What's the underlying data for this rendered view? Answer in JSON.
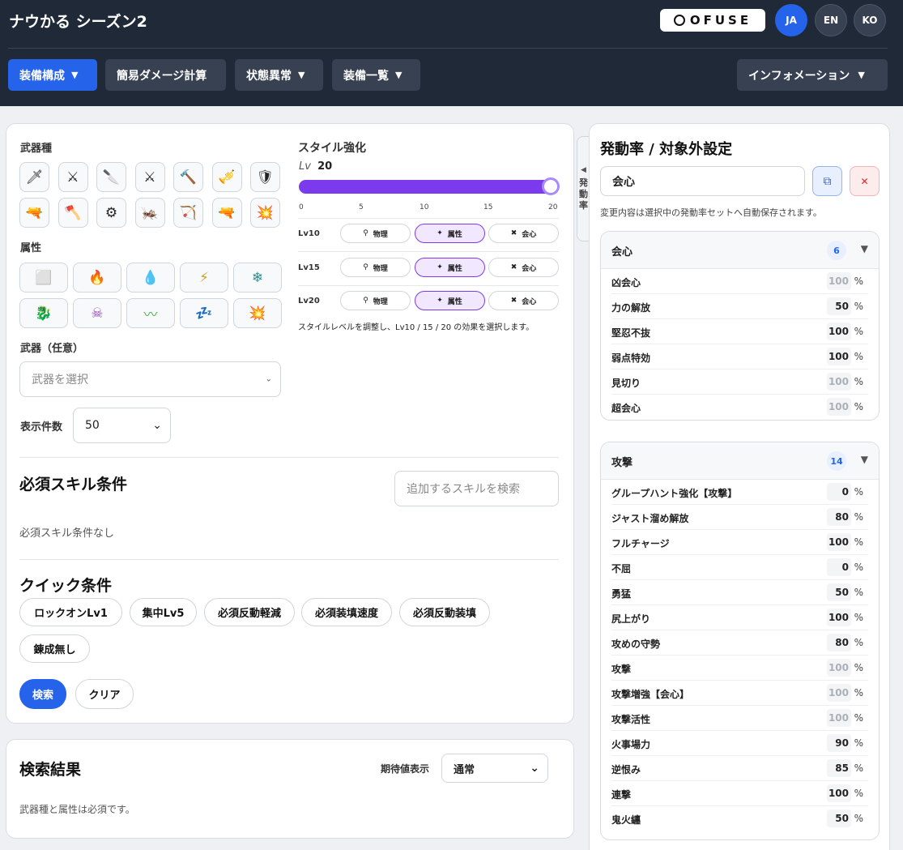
{
  "header": {
    "title": "ナウかる シーズン2",
    "ofuse_label": "OFUSE",
    "langs": [
      "JA",
      "EN",
      "KO"
    ],
    "nav": {
      "equip_build": "装備構成",
      "simple_damage": "簡易ダメージ計算",
      "status": "状態異常",
      "equip_list": "装備一覧",
      "information": "インフォメーション"
    }
  },
  "search_panel": {
    "weapon_type_label": "武器種",
    "attribute_label": "属性",
    "weapon_optional_label": "武器（任意）",
    "weapon_placeholder": "武器を選択",
    "count_label": "表示件数",
    "count_value": "50",
    "weapon_icons": [
      "sword-shield-icon",
      "dual-blades-icon",
      "great-sword-icon",
      "long-sword-icon",
      "hammer-icon",
      "hunting-horn-icon",
      "lance-icon",
      "gunlance-icon",
      "switch-axe-icon",
      "charge-blade-icon",
      "insect-glaive-icon",
      "bow-icon",
      "light-bowgun-icon",
      "heavy-bowgun-icon"
    ],
    "attribute_icons": [
      "none-icon",
      "fire-icon",
      "water-icon",
      "thunder-icon",
      "ice-icon",
      "dragon-icon",
      "poison-icon",
      "paralysis-icon",
      "sleep-icon",
      "blast-icon"
    ],
    "style": {
      "title": "スタイル強化",
      "lv_prefix": "Lv",
      "lv_value": "20",
      "level_fraction": 1.0,
      "ticks": [
        "0",
        "5",
        "10",
        "15",
        "20"
      ],
      "rows": [
        {
          "level": "Lv10",
          "options": [
            "物理",
            "属性",
            "会心"
          ],
          "selected": "属性"
        },
        {
          "level": "Lv15",
          "options": [
            "物理",
            "属性",
            "会心"
          ],
          "selected": "属性"
        },
        {
          "level": "Lv20",
          "options": [
            "物理",
            "属性",
            "会心"
          ],
          "selected": "属性"
        }
      ],
      "note": "スタイルレベルを調整し、Lv10 / 15 / 20 の効果を選択します。"
    },
    "required_skills": {
      "title": "必須スキル条件",
      "search_placeholder": "追加するスキルを検索",
      "empty": "必須スキル条件なし"
    },
    "quick": {
      "title": "クイック条件",
      "chips": [
        "ロックオンLv1",
        "集中Lv5",
        "必須反動軽減",
        "必須装填速度",
        "必須反動装填",
        "錬成無し"
      ]
    },
    "buttons": {
      "search": "検索",
      "clear": "クリア"
    }
  },
  "results": {
    "title": "検索結果",
    "expected_label": "期待値表示",
    "expected_value": "通常",
    "message": "武器種と属性は必須です。"
  },
  "side": {
    "tab_label": [
      "発",
      "動",
      "率"
    ],
    "title": "発動率 / 対象外設定",
    "set_name": "会心",
    "note": "変更内容は選択中の発動率セットへ自動保存されます。",
    "groups": [
      {
        "title": "会心",
        "count": "6",
        "items": [
          {
            "name": "凶会心",
            "value": "100",
            "dim": true
          },
          {
            "name": "力の解放",
            "value": "50",
            "dim": false
          },
          {
            "name": "堅忍不抜",
            "value": "100",
            "dim": false
          },
          {
            "name": "弱点特効",
            "value": "100",
            "dim": false
          },
          {
            "name": "見切り",
            "value": "100",
            "dim": true
          },
          {
            "name": "超会心",
            "value": "100",
            "dim": true
          }
        ]
      },
      {
        "title": "攻撃",
        "count": "14",
        "items": [
          {
            "name": "グループハント強化【攻撃】",
            "value": "0",
            "dim": false
          },
          {
            "name": "ジャスト溜め解放",
            "value": "80",
            "dim": false
          },
          {
            "name": "フルチャージ",
            "value": "100",
            "dim": false
          },
          {
            "name": "不屈",
            "value": "0",
            "dim": false
          },
          {
            "name": "勇猛",
            "value": "50",
            "dim": false
          },
          {
            "name": "尻上がり",
            "value": "100",
            "dim": false
          },
          {
            "name": "攻めの守勢",
            "value": "80",
            "dim": false
          },
          {
            "name": "攻撃",
            "value": "100",
            "dim": true
          },
          {
            "name": "攻撃増強【会心】",
            "value": "100",
            "dim": true
          },
          {
            "name": "攻撃活性",
            "value": "100",
            "dim": true
          },
          {
            "name": "火事場力",
            "value": "90",
            "dim": false
          },
          {
            "name": "逆恨み",
            "value": "85",
            "dim": false
          },
          {
            "name": "連撃",
            "value": "100",
            "dim": false
          },
          {
            "name": "鬼火纏",
            "value": "50",
            "dim": false
          }
        ]
      }
    ],
    "percent": "%"
  }
}
